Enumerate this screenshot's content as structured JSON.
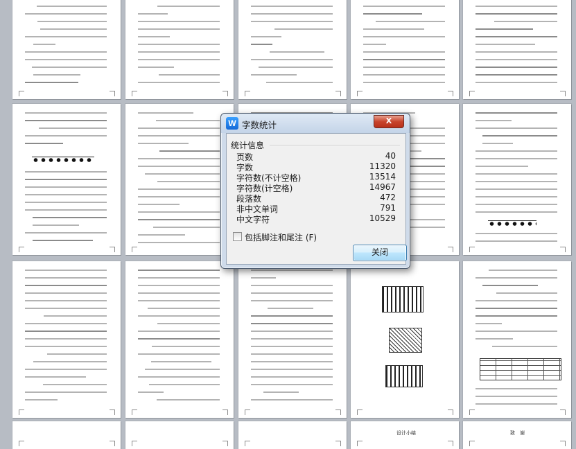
{
  "dialog": {
    "title": "字数统计",
    "close_glyph": "X",
    "app_icon_letter": "W",
    "group_label": "统计信息",
    "stats": [
      {
        "label": "页数",
        "value": "40"
      },
      {
        "label": "字数",
        "value": "11320"
      },
      {
        "label": "字符数(不计空格)",
        "value": "13514"
      },
      {
        "label": "字符数(计空格)",
        "value": "14967"
      },
      {
        "label": "段落数",
        "value": "472"
      },
      {
        "label": "非中文单词",
        "value": "791"
      },
      {
        "label": "中文字符",
        "value": "10529"
      }
    ],
    "checkbox_label": "包括脚注和尾注",
    "checkbox_shortcut": "(F)",
    "checkbox_checked": false,
    "close_button_label": "关闭"
  },
  "document": {
    "page_titles": [
      "设计小结",
      "致　谢"
    ]
  },
  "colors": {
    "background": "#b7bcc4",
    "dialog_frame": "#cfdbea",
    "close_red": "#c8442c",
    "button_blue": "#bee6fd"
  }
}
